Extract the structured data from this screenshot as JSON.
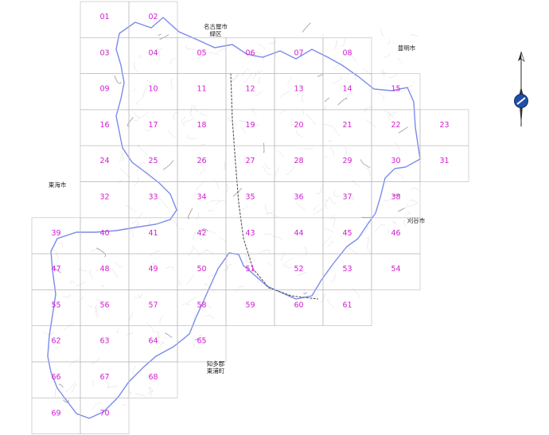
{
  "tiles": [
    {
      "id": "01",
      "col": 1,
      "row": 0
    },
    {
      "id": "02",
      "col": 2,
      "row": 0
    },
    {
      "id": "03",
      "col": 1,
      "row": 1
    },
    {
      "id": "04",
      "col": 2,
      "row": 1
    },
    {
      "id": "05",
      "col": 3,
      "row": 1
    },
    {
      "id": "06",
      "col": 4,
      "row": 1
    },
    {
      "id": "07",
      "col": 5,
      "row": 1
    },
    {
      "id": "08",
      "col": 6,
      "row": 1
    },
    {
      "id": "09",
      "col": 1,
      "row": 2
    },
    {
      "id": "10",
      "col": 2,
      "row": 2
    },
    {
      "id": "11",
      "col": 3,
      "row": 2
    },
    {
      "id": "12",
      "col": 4,
      "row": 2
    },
    {
      "id": "13",
      "col": 5,
      "row": 2
    },
    {
      "id": "14",
      "col": 6,
      "row": 2
    },
    {
      "id": "15",
      "col": 7,
      "row": 2
    },
    {
      "id": "16",
      "col": 1,
      "row": 3
    },
    {
      "id": "17",
      "col": 2,
      "row": 3
    },
    {
      "id": "18",
      "col": 3,
      "row": 3
    },
    {
      "id": "19",
      "col": 4,
      "row": 3
    },
    {
      "id": "20",
      "col": 5,
      "row": 3
    },
    {
      "id": "21",
      "col": 6,
      "row": 3
    },
    {
      "id": "22",
      "col": 7,
      "row": 3
    },
    {
      "id": "23",
      "col": 8,
      "row": 3
    },
    {
      "id": "24",
      "col": 1,
      "row": 4
    },
    {
      "id": "25",
      "col": 2,
      "row": 4
    },
    {
      "id": "26",
      "col": 3,
      "row": 4
    },
    {
      "id": "27",
      "col": 4,
      "row": 4
    },
    {
      "id": "28",
      "col": 5,
      "row": 4
    },
    {
      "id": "29",
      "col": 6,
      "row": 4
    },
    {
      "id": "30",
      "col": 7,
      "row": 4
    },
    {
      "id": "31",
      "col": 8,
      "row": 4
    },
    {
      "id": "32",
      "col": 1,
      "row": 5
    },
    {
      "id": "33",
      "col": 2,
      "row": 5
    },
    {
      "id": "34",
      "col": 3,
      "row": 5
    },
    {
      "id": "35",
      "col": 4,
      "row": 5
    },
    {
      "id": "36",
      "col": 5,
      "row": 5
    },
    {
      "id": "37",
      "col": 6,
      "row": 5
    },
    {
      "id": "38",
      "col": 7,
      "row": 5
    },
    {
      "id": "39",
      "col": 0,
      "row": 6
    },
    {
      "id": "40",
      "col": 1,
      "row": 6
    },
    {
      "id": "41",
      "col": 2,
      "row": 6
    },
    {
      "id": "42",
      "col": 3,
      "row": 6
    },
    {
      "id": "43",
      "col": 4,
      "row": 6
    },
    {
      "id": "44",
      "col": 5,
      "row": 6
    },
    {
      "id": "45",
      "col": 6,
      "row": 6
    },
    {
      "id": "46",
      "col": 7,
      "row": 6
    },
    {
      "id": "47",
      "col": 0,
      "row": 7
    },
    {
      "id": "48",
      "col": 1,
      "row": 7
    },
    {
      "id": "49",
      "col": 2,
      "row": 7
    },
    {
      "id": "50",
      "col": 3,
      "row": 7
    },
    {
      "id": "51",
      "col": 4,
      "row": 7
    },
    {
      "id": "52",
      "col": 5,
      "row": 7
    },
    {
      "id": "53",
      "col": 6,
      "row": 7
    },
    {
      "id": "54",
      "col": 7,
      "row": 7
    },
    {
      "id": "55",
      "col": 0,
      "row": 8
    },
    {
      "id": "56",
      "col": 1,
      "row": 8
    },
    {
      "id": "57",
      "col": 2,
      "row": 8
    },
    {
      "id": "58",
      "col": 3,
      "row": 8
    },
    {
      "id": "59",
      "col": 4,
      "row": 8
    },
    {
      "id": "60",
      "col": 5,
      "row": 8
    },
    {
      "id": "61",
      "col": 6,
      "row": 8
    },
    {
      "id": "62",
      "col": 0,
      "row": 9
    },
    {
      "id": "63",
      "col": 1,
      "row": 9
    },
    {
      "id": "64",
      "col": 2,
      "row": 9
    },
    {
      "id": "65",
      "col": 3,
      "row": 9
    },
    {
      "id": "66",
      "col": 0,
      "row": 10
    },
    {
      "id": "67",
      "col": 1,
      "row": 10
    },
    {
      "id": "68",
      "col": 2,
      "row": 10
    },
    {
      "id": "69",
      "col": 0,
      "row": 11
    },
    {
      "id": "70",
      "col": 1,
      "row": 11
    }
  ],
  "labels": {
    "nagoya": [
      "名古屋市",
      "緑区"
    ],
    "toyoake": "豊明市",
    "tokai": "東海市",
    "kariya": "刈谷市",
    "chita": [
      "知多郡",
      "東浦町"
    ]
  },
  "colors": {
    "tile_label": "#d21cd2",
    "boundary": "#7b8bea",
    "grid": "#b8b8b8",
    "compass": "#1f4fa8"
  },
  "icons": {
    "compass": "north-arrow-compass-icon"
  }
}
